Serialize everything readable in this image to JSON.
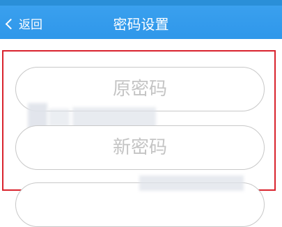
{
  "header": {
    "back_label": "返回",
    "title": "密码设置"
  },
  "form": {
    "old_password_placeholder": "原密码",
    "new_password_placeholder": "新密码",
    "confirm_password_placeholder": ""
  },
  "colors": {
    "header_bg": "#3aa0ee",
    "highlight_border": "#d9232d",
    "field_border": "#c8c8c8"
  },
  "icons": {
    "back": "chevron-left-icon"
  }
}
